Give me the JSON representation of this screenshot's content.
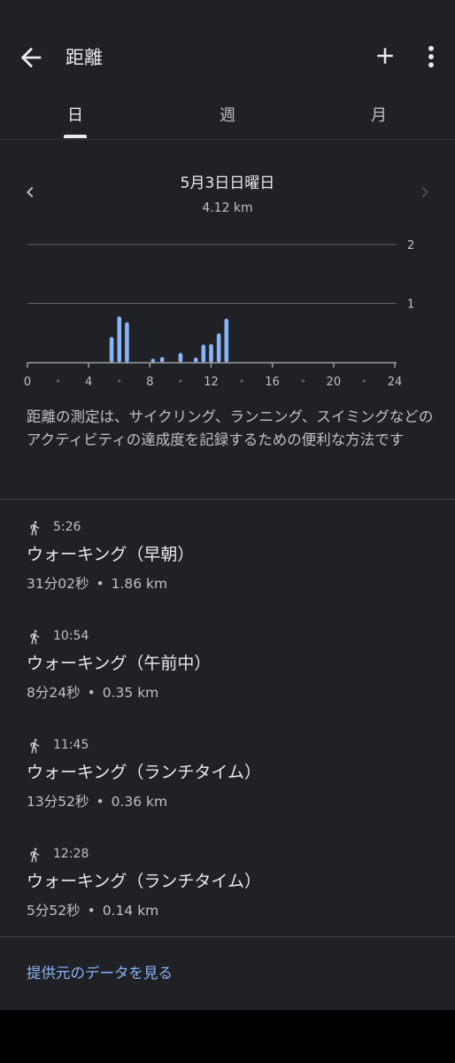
{
  "header": {
    "title": "距離"
  },
  "icons": {
    "back": "arrow-left-icon",
    "add": "plus-icon",
    "more": "more-vert-icon",
    "prev": "chevron-left-icon",
    "next": "chevron-right-icon",
    "walk": "walking-person-icon"
  },
  "tabs": [
    {
      "label": "日",
      "active": true
    },
    {
      "label": "週",
      "active": false
    },
    {
      "label": "月",
      "active": false
    }
  ],
  "date": {
    "title": "5月3日日曜日",
    "total": "4.12 km"
  },
  "chart_data": {
    "type": "bar",
    "x": [
      5.5,
      6,
      6.5,
      8.2,
      8.8,
      10,
      11,
      11.5,
      12,
      12.5,
      13
    ],
    "values": [
      0.43,
      0.78,
      0.68,
      0.06,
      0.09,
      0.16,
      0.08,
      0.3,
      0.31,
      0.49,
      0.74
    ],
    "xlim": [
      0,
      24
    ],
    "ylim": [
      0,
      2
    ],
    "x_ticks": [
      "0",
      "4",
      "8",
      "12",
      "16",
      "20",
      "24"
    ],
    "y_ticks": [
      "1",
      "2"
    ],
    "grid": true,
    "bar_color": "#8ab4f8"
  },
  "description": "距離の測定は、サイクリング、ランニング、スイミングなどのアクティビティの達成度を記録するための便利な方法です",
  "activities": [
    {
      "time": "5:26",
      "name": "ウォーキング（早朝）",
      "duration": "31分02秒",
      "distance": "1.86 km"
    },
    {
      "time": "10:54",
      "name": "ウォーキング（午前中）",
      "duration": "8分24秒",
      "distance": "0.35 km"
    },
    {
      "time": "11:45",
      "name": "ウォーキング（ランチタイム）",
      "duration": "13分52秒",
      "distance": "0.36 km"
    },
    {
      "time": "12:28",
      "name": "ウォーキング（ランチタイム）",
      "duration": "5分52秒",
      "distance": "0.14 km"
    }
  ],
  "meta_separator": "•",
  "footer": {
    "source_link": "提供元のデータを見る"
  },
  "colors": {
    "background": "#202124",
    "accent": "#8ab4f8",
    "text": "#e8eaed",
    "muted": "#bdc1c6"
  }
}
